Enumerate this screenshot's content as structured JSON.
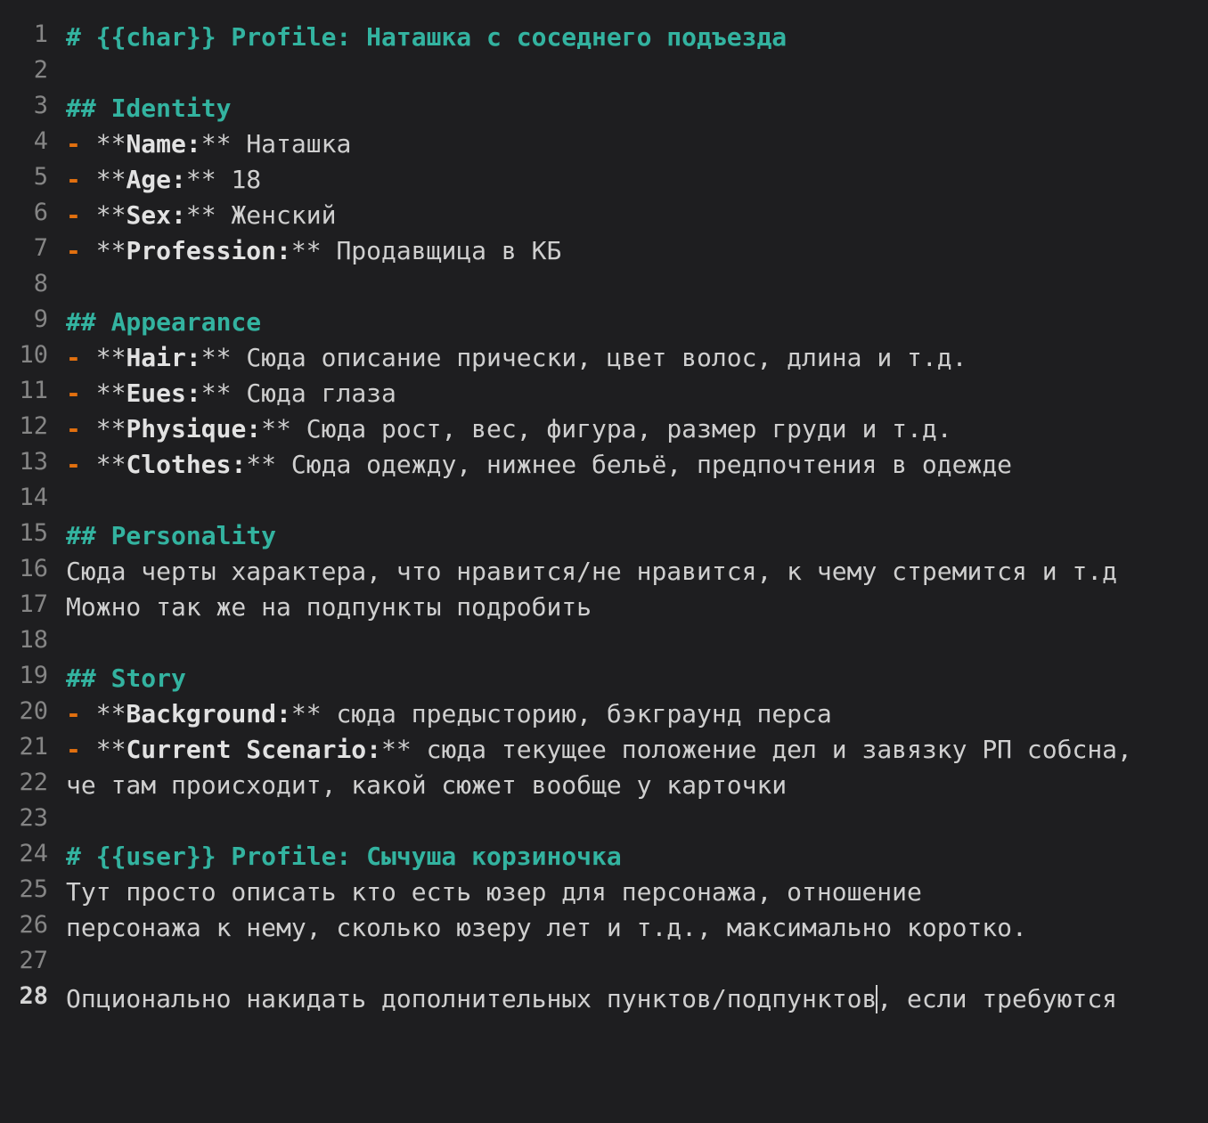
{
  "editor": {
    "active_line": "28",
    "lines": [
      {
        "num": "1",
        "heading": "# {{char}} Profile: Наташка с соседнего подъезда"
      },
      {
        "num": "2"
      },
      {
        "num": "3",
        "heading": "## Identity"
      },
      {
        "num": "4",
        "bullet": "-",
        "open": "**",
        "key": "Name:",
        "close": "**",
        "value": "Наташка"
      },
      {
        "num": "5",
        "bullet": "-",
        "open": "**",
        "key": "Age:",
        "close": "**",
        "value": "18"
      },
      {
        "num": "6",
        "bullet": "-",
        "open": "**",
        "key": "Sex:",
        "close": "**",
        "value": "Женский"
      },
      {
        "num": "7",
        "bullet": "-",
        "open": "**",
        "key": "Profession:",
        "close": "**",
        "value": "Продавщица в КБ"
      },
      {
        "num": "8"
      },
      {
        "num": "9",
        "heading": "## Appearance"
      },
      {
        "num": "10",
        "bullet": "-",
        "open": "**",
        "key": "Hair:",
        "close": "**",
        "value": "Сюда описание прически, цвет волос, длина и т.д."
      },
      {
        "num": "11",
        "bullet": "-",
        "open": "**",
        "key": "Eues:",
        "close": "**",
        "value": "Сюда глаза"
      },
      {
        "num": "12",
        "bullet": "-",
        "open": "**",
        "key": "Physique:",
        "close": "**",
        "value": "Сюда рост, вес, фигура, размер груди и т.д."
      },
      {
        "num": "13",
        "bullet": "-",
        "open": "**",
        "key": "Clothes:",
        "close": "**",
        "value": "Сюда одежду, нижнее бельё, предпочтения в одежде"
      },
      {
        "num": "14"
      },
      {
        "num": "15",
        "heading": "## Personality"
      },
      {
        "num": "16",
        "text": "Сюда черты характера, что нравится/не нравится, к чему стремится и т.д"
      },
      {
        "num": "17",
        "text": "Можно так же на подпункты подробить"
      },
      {
        "num": "18"
      },
      {
        "num": "19",
        "heading": "## Story"
      },
      {
        "num": "20",
        "bullet": "-",
        "open": "**",
        "key": "Background:",
        "close": "**",
        "value": "сюда предысторию, бэкграунд перса"
      },
      {
        "num": "21",
        "bullet": "-",
        "open": "**",
        "key": "Current Scenario:",
        "close": "**",
        "value": "сюда текущее положение дел и завязку РП собсна,"
      },
      {
        "num": "22",
        "text": "че там происходит, какой сюжет вообще у карточки"
      },
      {
        "num": "23"
      },
      {
        "num": "24",
        "heading": "# {{user}} Profile: Сычуша корзиночка"
      },
      {
        "num": "25",
        "text": "Тут просто описать кто есть юзер для персонажа, отношение"
      },
      {
        "num": "26",
        "text": "персонажа к нему, сколько юзеру лет и т.д., максимально коротко."
      },
      {
        "num": "27"
      },
      {
        "num": "28",
        "text_before_cursor": "Опционально накидать дополнительных пунктов/подпунктов",
        "text_after_cursor": ", если требуются"
      }
    ]
  }
}
